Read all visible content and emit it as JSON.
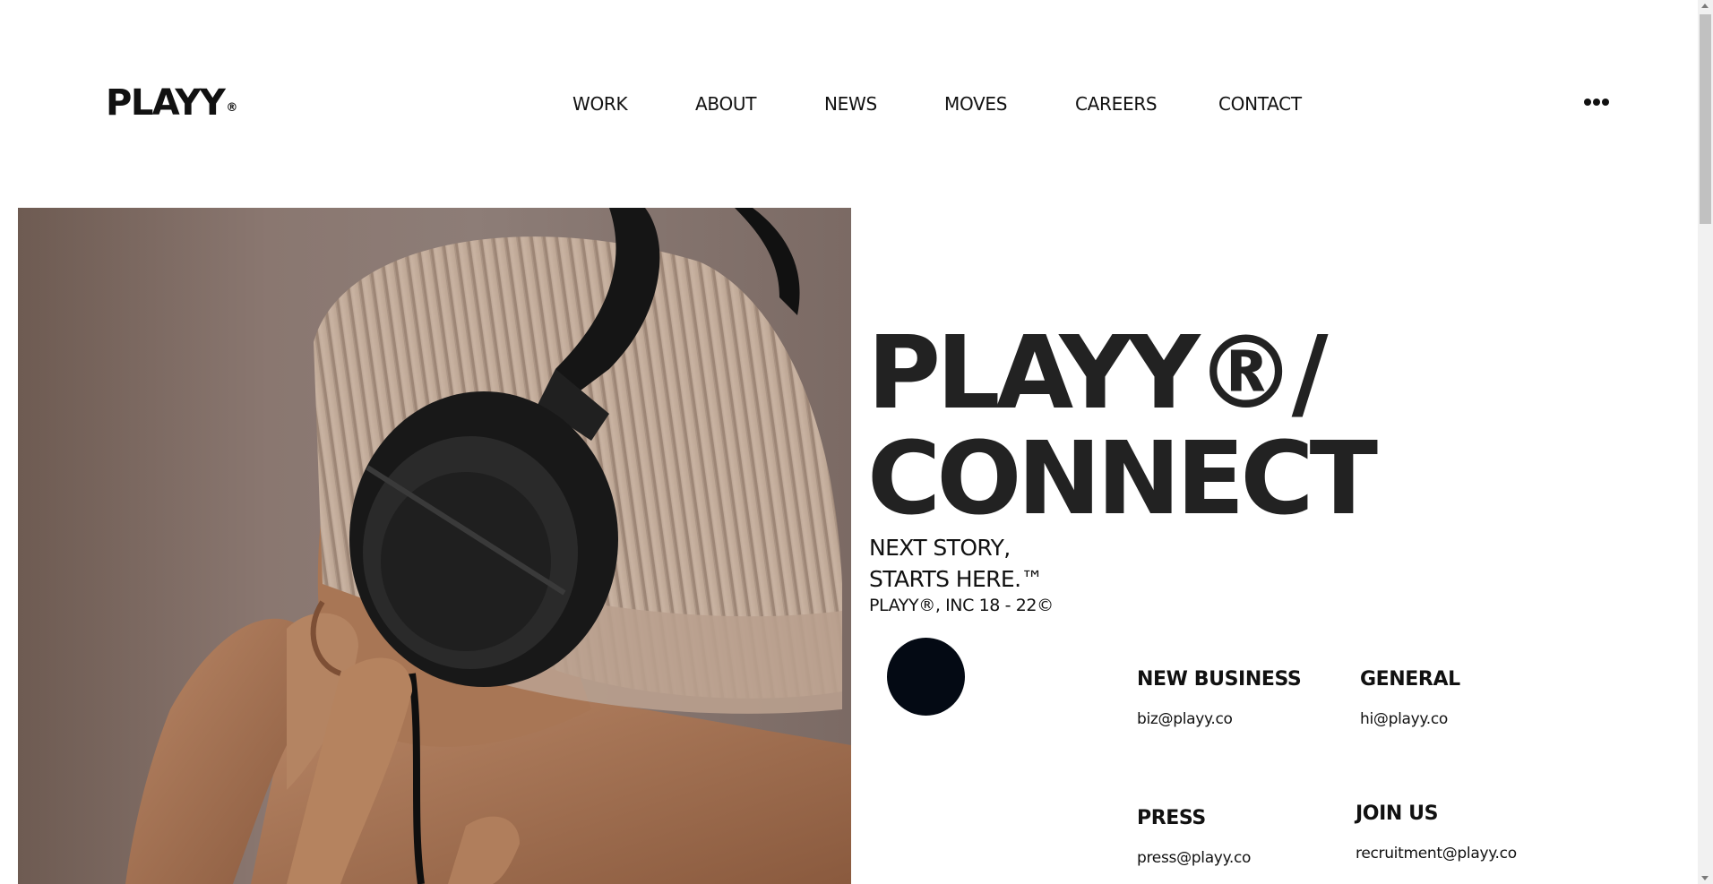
{
  "header": {
    "logo_text": "PLAYY",
    "logo_mark": "®",
    "nav": [
      {
        "label": "WORK"
      },
      {
        "label": "ABOUT"
      },
      {
        "label": "NEWS"
      },
      {
        "label": "MOVES"
      },
      {
        "label": "CAREERS"
      },
      {
        "label": "CONTACT"
      }
    ],
    "more_icon": "ellipsis-icon"
  },
  "hero": {
    "photo": "person-with-headphones-photo",
    "headline_line1": "PLAYY®/",
    "headline_line2": "CONNECT",
    "tagline_line1": "NEXT STORY,",
    "tagline_line2": "STARTS HERE.™",
    "copyright": "PLAYY®, INC 18 - 22©"
  },
  "contacts": [
    {
      "heading": "NEW BUSINESS",
      "email": "biz@playy.co"
    },
    {
      "heading": "GENERAL",
      "email": "hi@playy.co"
    },
    {
      "heading": "PRESS",
      "email": "press@playy.co"
    },
    {
      "heading": "JOIN US",
      "email": "recruitment@playy.co"
    }
  ],
  "colors": {
    "background": "#ffffff",
    "text": "#1e1e1e",
    "accent_dot": "#040a14"
  }
}
